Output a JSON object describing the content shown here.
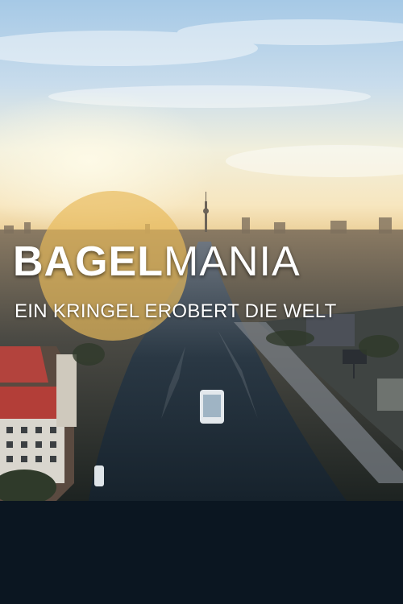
{
  "poster": {
    "title_bold": "BAGEL",
    "title_light": "MANIA",
    "subtitle": "EIN KRINGEL EROBERT DIE WELT"
  },
  "colors": {
    "title_text": "#ffffff",
    "bagel_circle": "#e8b95a",
    "bottom_band": "#0b1621",
    "river": "#1c2a36",
    "sky_top": "#9cc3e4"
  }
}
